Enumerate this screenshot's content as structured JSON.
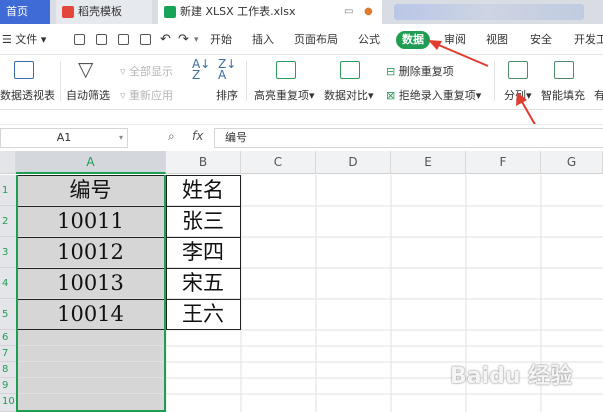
{
  "tabs": [
    {
      "label": "首页"
    },
    {
      "label": "稻壳模板"
    },
    {
      "label": "新建 XLSX 工作表.xlsx"
    }
  ],
  "menu": {
    "file": "文件",
    "items": [
      "开始",
      "插入",
      "页面布局",
      "公式",
      "数据",
      "审阅",
      "视图",
      "安全",
      "开发工"
    ]
  },
  "ribbon": {
    "pivot": "数据透视表",
    "autofilter": "自动筛选",
    "show_all": "全部显示",
    "reapply": "重新应用",
    "sort": "排序",
    "highlight_dup": "高亮重复项",
    "compare": "数据对比",
    "remove_dup": "删除重复项",
    "reject_dup": "拒绝录入重复项",
    "split": "分列",
    "smart_fill": "智能填充",
    "more": "有"
  },
  "formula_bar": {
    "namebox": "A1",
    "fx": "fx",
    "value": "编号"
  },
  "columns": [
    "A",
    "B",
    "C",
    "D",
    "E",
    "F",
    "G"
  ],
  "rows": [
    "1",
    "2",
    "3",
    "4",
    "5",
    "6",
    "7",
    "8",
    "9",
    "10"
  ],
  "cells": [
    [
      "编号",
      "姓名"
    ],
    [
      "10011",
      "张三"
    ],
    [
      "10012",
      "李四"
    ],
    [
      "10013",
      "宋五"
    ],
    [
      "10014",
      "王六"
    ]
  ],
  "accent": "#1f9d53",
  "watermark": "Baidu 经验"
}
